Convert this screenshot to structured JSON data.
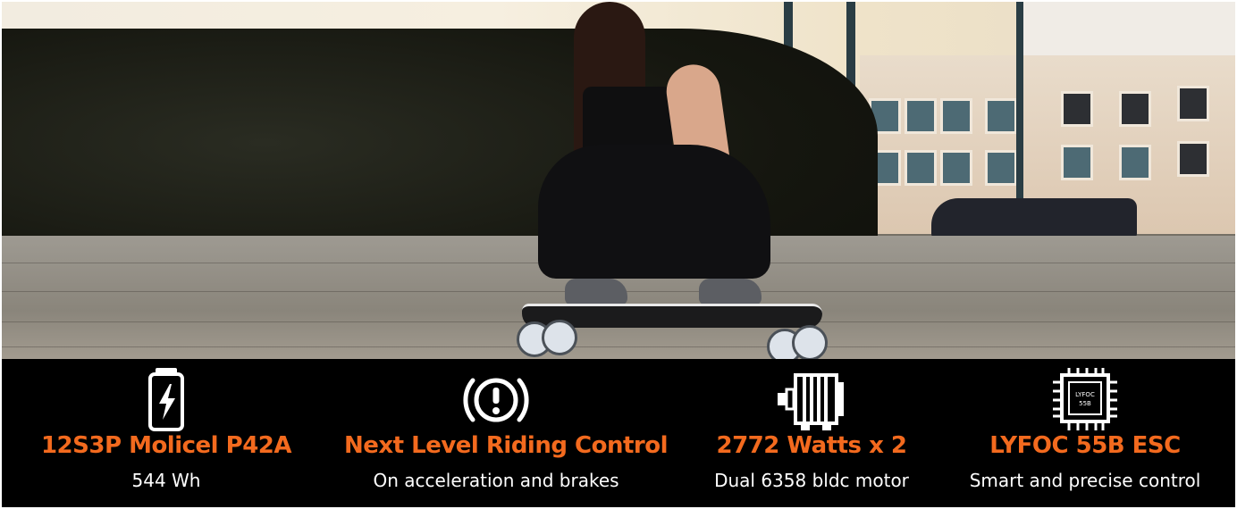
{
  "features": [
    {
      "icon": "battery-charging-icon",
      "title": "12S3P Molicel P42A",
      "subtitle": "544 Wh"
    },
    {
      "icon": "brake-warning-icon",
      "title": "Next Level Riding Control",
      "subtitle": "On acceleration and brakes"
    },
    {
      "icon": "electric-motor-icon",
      "title": "2772 Watts x 2",
      "subtitle": "Dual 6358 bldc motor"
    },
    {
      "icon": "chip-icon",
      "chip_label_line1": "LYFOC",
      "chip_label_line2": "55B",
      "title": "LYFOC 55B ESC",
      "subtitle": "Smart and precise control"
    }
  ],
  "colors": {
    "accent": "#f36a1e",
    "footer_background": "#000000",
    "subtitle_text": "#ffffff"
  }
}
